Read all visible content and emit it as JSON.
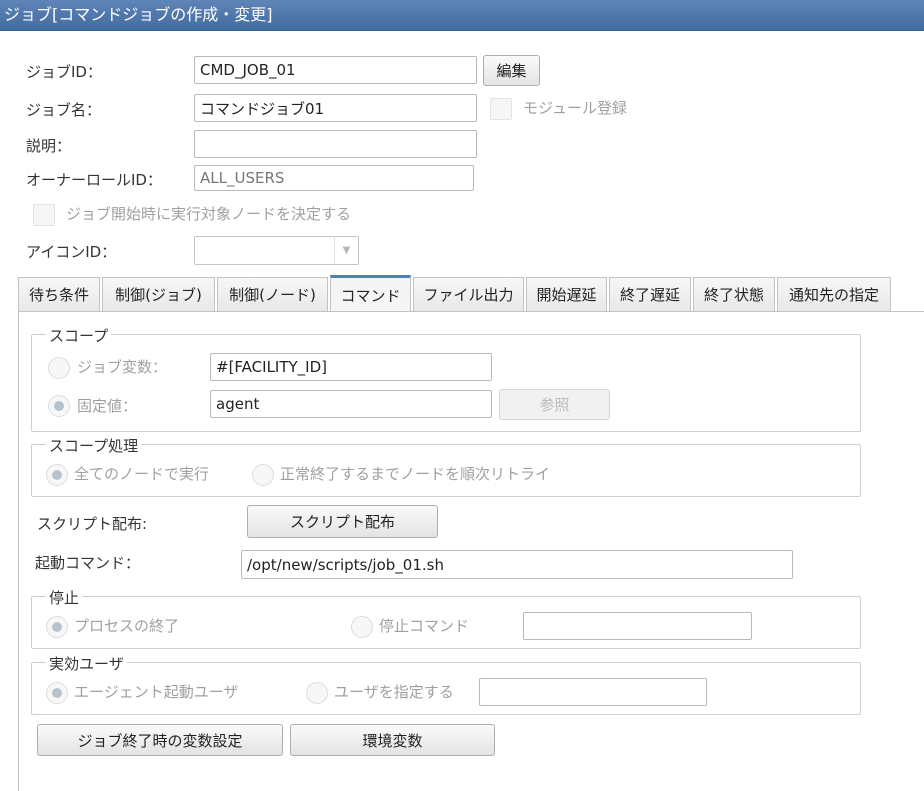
{
  "window": {
    "title": "ジョブ[コマンドジョブの作成・変更]"
  },
  "form": {
    "job_id_label": "ジョブID：",
    "job_id_value": "CMD_JOB_01",
    "edit_button": "編集",
    "job_name_label": "ジョブ名：",
    "job_name_value": "コマンドジョブ01",
    "module_register_label": "モジュール登録",
    "description_label": "説明：",
    "description_value": "",
    "owner_role_label": "オーナーロールID：",
    "owner_role_value": "ALL_USERS",
    "decide_node_label": "ジョブ開始時に実行対象ノードを決定する",
    "icon_id_label": "アイコンID：",
    "icon_id_value": ""
  },
  "tabs": [
    {
      "label": "待ち条件"
    },
    {
      "label": "制御(ジョブ)"
    },
    {
      "label": "制御(ノード)"
    },
    {
      "label": "コマンド",
      "active": true
    },
    {
      "label": "ファイル出力"
    },
    {
      "label": "開始遅延"
    },
    {
      "label": "終了遅延"
    },
    {
      "label": "終了状態"
    },
    {
      "label": "通知先の指定"
    }
  ],
  "command_tab": {
    "scope": {
      "title": "スコープ",
      "job_variable_label": "ジョブ変数：",
      "job_variable_value": "#[FACILITY_ID]",
      "fixed_value_label": "固定値：",
      "fixed_value_value": "agent",
      "browse_button": "参照"
    },
    "scope_process": {
      "title": "スコープ処理",
      "all_nodes_label": "全てのノードで実行",
      "retry_label": "正常終了するまでノードを順次リトライ"
    },
    "script_dist_label": "スクリプト配布:",
    "script_dist_button": "スクリプト配布",
    "start_command_label": "起動コマンド：",
    "start_command_value": "/opt/new/scripts/job_01.sh",
    "stop": {
      "title": "停止",
      "process_end_label": "プロセスの終了",
      "stop_command_label": "停止コマンド",
      "stop_command_value": ""
    },
    "effective_user": {
      "title": "実効ユーザ",
      "agent_user_label": "エージェント起動ユーザ",
      "specify_user_label": "ユーザを指定する",
      "specify_user_value": ""
    },
    "job_end_var_button": "ジョブ終了時の変数設定",
    "env_var_button": "環境変数"
  }
}
